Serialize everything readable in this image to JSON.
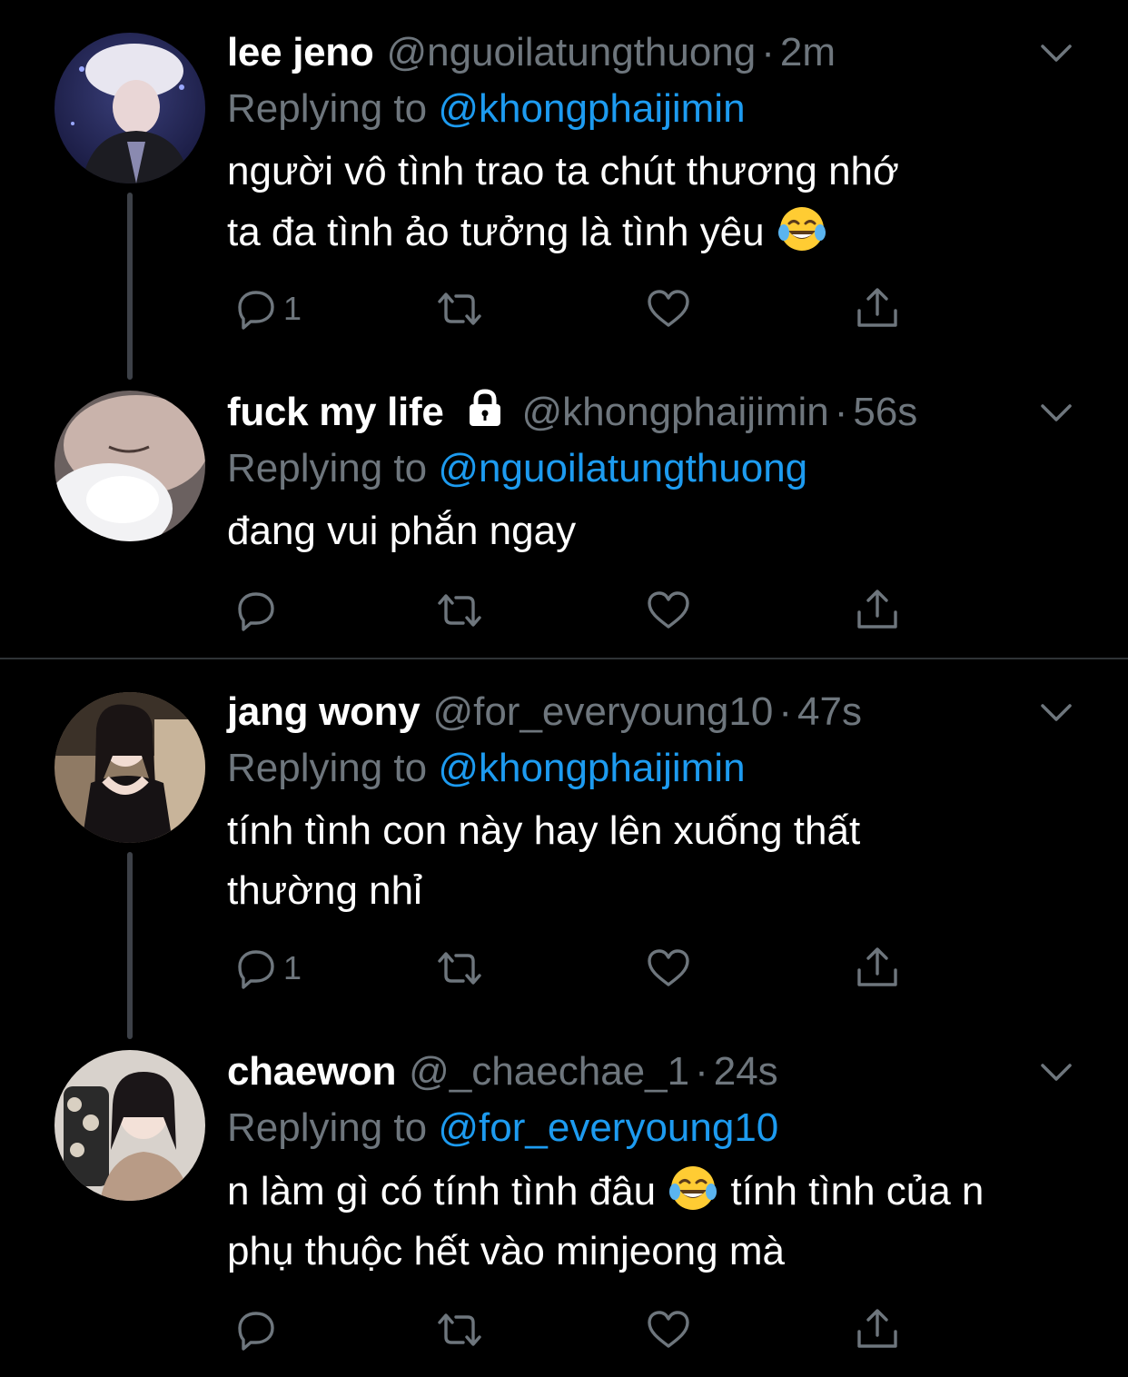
{
  "colors": {
    "background": "#000000",
    "text_primary": "#ffffff",
    "text_secondary": "#6e767d",
    "link": "#1d9bf0",
    "thread_line": "#3d4148",
    "separator": "#2f3336"
  },
  "tweets": [
    {
      "display_name": "lee jeno",
      "handle": "@nguoilatungthuong",
      "dot": "·",
      "time": "2m",
      "replying_label": "Replying to ",
      "replying_to": "@khongphaijimin",
      "text": "người vô tình trao ta chút thương nhớ\nta đa tình ảo tưởng là tình yêu ",
      "emoji": "face-with-tears-of-joy",
      "reply_count": "1",
      "locked": false
    },
    {
      "display_name": "fuck my life",
      "handle": "@khongphaijimin",
      "dot": "·",
      "time": "56s",
      "replying_label": "Replying to ",
      "replying_to": "@nguoilatungthuong",
      "text": "đang vui phắn ngay",
      "reply_count": "",
      "locked": true
    },
    {
      "display_name": "jang wony",
      "handle": "@for_everyoung10",
      "dot": "·",
      "time": "47s",
      "replying_label": "Replying to ",
      "replying_to": "@khongphaijimin",
      "text": "tính tình con này hay lên xuống thất\nthường nhỉ",
      "reply_count": "1",
      "locked": false
    },
    {
      "display_name": "chaewon",
      "handle": "@_chaechae_1",
      "dot": "·",
      "time": "24s",
      "replying_label": "Replying to ",
      "replying_to": "@for_everyoung10",
      "text_part1": "n làm gì có tính tình đâu ",
      "emoji": "face-with-tears-of-joy",
      "text_part2": " tính tình của n\nphụ thuộc hết vào minjeong mà",
      "reply_count": "",
      "locked": false
    }
  ]
}
